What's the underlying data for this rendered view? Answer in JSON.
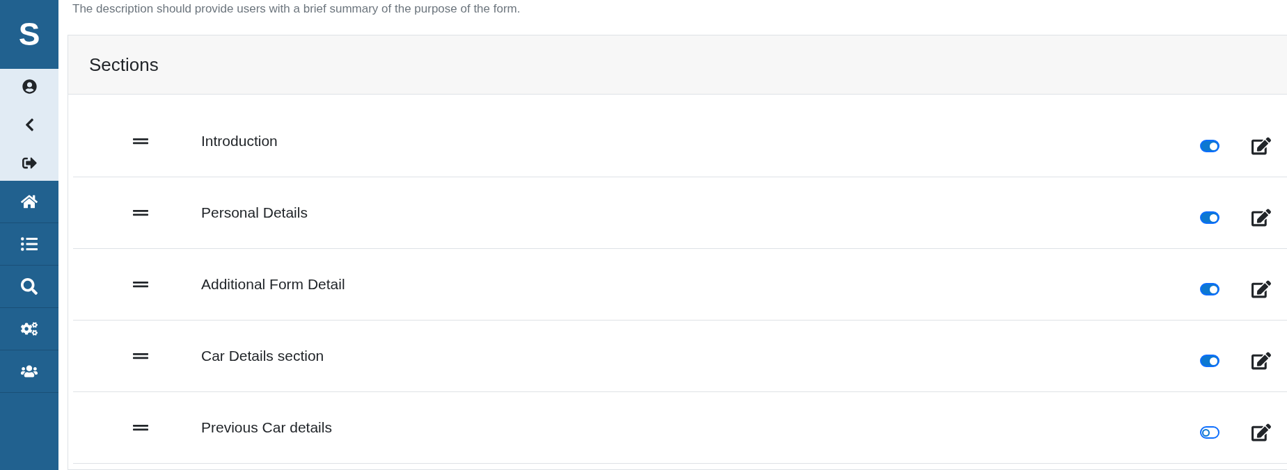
{
  "sidebar": {
    "logo": "S"
  },
  "description": "The description should provide users with a brief summary of the purpose of the form.",
  "sections_card": {
    "title": "Sections",
    "rows": [
      {
        "label": "Introduction",
        "on": true
      },
      {
        "label": "Personal Details",
        "on": true
      },
      {
        "label": "Additional Form Detail",
        "on": true
      },
      {
        "label": "Car Details section",
        "on": true
      },
      {
        "label": "Previous Car details",
        "on": false
      }
    ]
  }
}
